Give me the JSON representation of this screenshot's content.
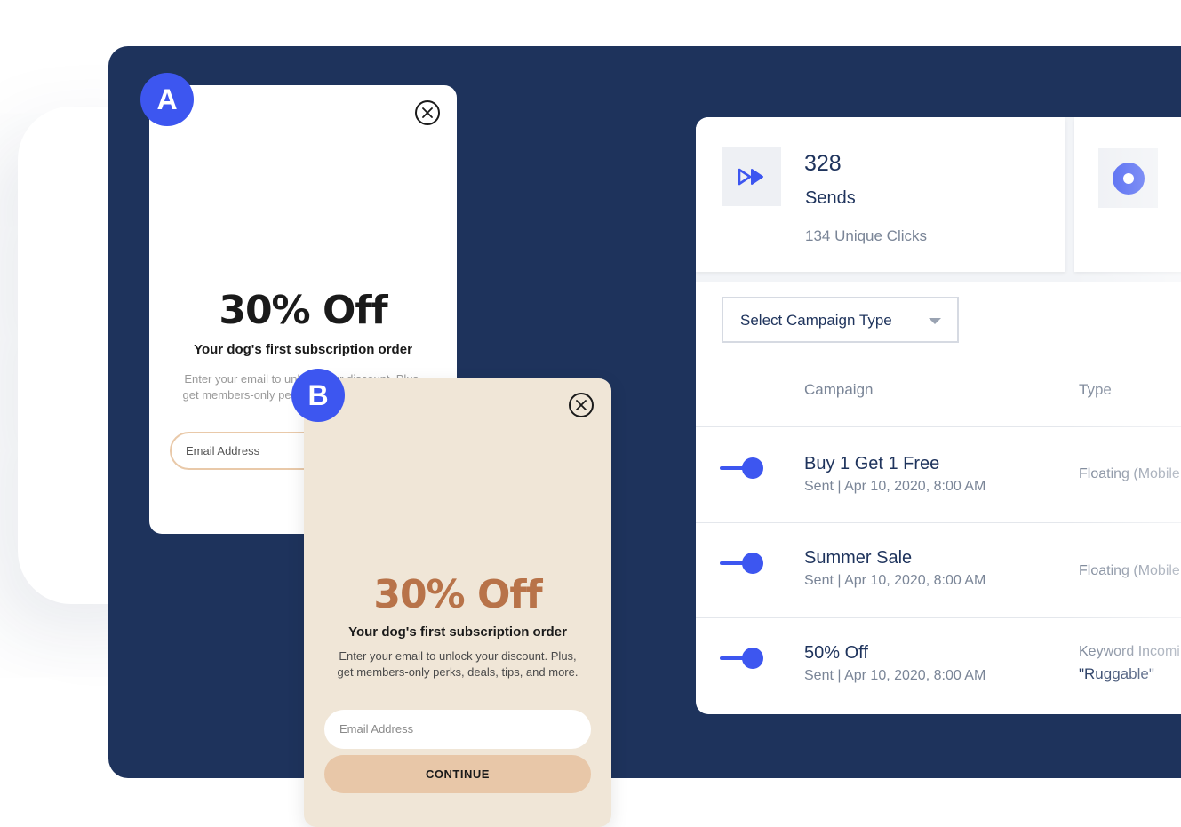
{
  "dashboard": {
    "stats": [
      {
        "icon": "fast-forward-icon",
        "value": "328",
        "label": "Sends",
        "sub": "134 Unique Clicks"
      },
      {
        "icon": "record-dot-icon"
      }
    ],
    "filter": {
      "label": "Select Campaign Type"
    },
    "table": {
      "headers": {
        "campaign": "Campaign",
        "type": "Type"
      },
      "rows": [
        {
          "name": "Buy 1 Get 1 Free",
          "sent": "Sent | Apr 10, 2020, 8:00 AM",
          "type": "Floating (Mobile",
          "type2": ""
        },
        {
          "name": "Summer Sale",
          "sent": "Sent | Apr 10, 2020, 8:00 AM",
          "type": "Floating (Mobile",
          "type2": ""
        },
        {
          "name": "50% Off",
          "sent": "Sent | Apr 10, 2020, 8:00 AM",
          "type": "Keyword Incomi",
          "type2": "\"Ruggable\""
        }
      ]
    },
    "colors": {
      "accent": "#3d56f0",
      "navy": "#1e335c"
    }
  },
  "popup_a": {
    "badge": "A",
    "headline": "30% Off",
    "subhead": "Your dog's first subscription order",
    "body": "Enter your email to unlock your discount. Plus, get members-only perks, deals, tips, and more.",
    "email_placeholder": "Email Address",
    "colors": {
      "background": "#ffffff",
      "headline": "#1a1a1a"
    }
  },
  "popup_b": {
    "badge": "B",
    "headline": "30% Off",
    "subhead": "Your dog's first subscription order",
    "body": "Enter your email to unlock your discount. Plus, get members-only perks, deals, tips, and more.",
    "email_placeholder": "Email Address",
    "cta": "CONTINUE",
    "colors": {
      "background": "#f0e6d7",
      "headline": "#b87349",
      "cta": "#e8c7a8"
    }
  }
}
